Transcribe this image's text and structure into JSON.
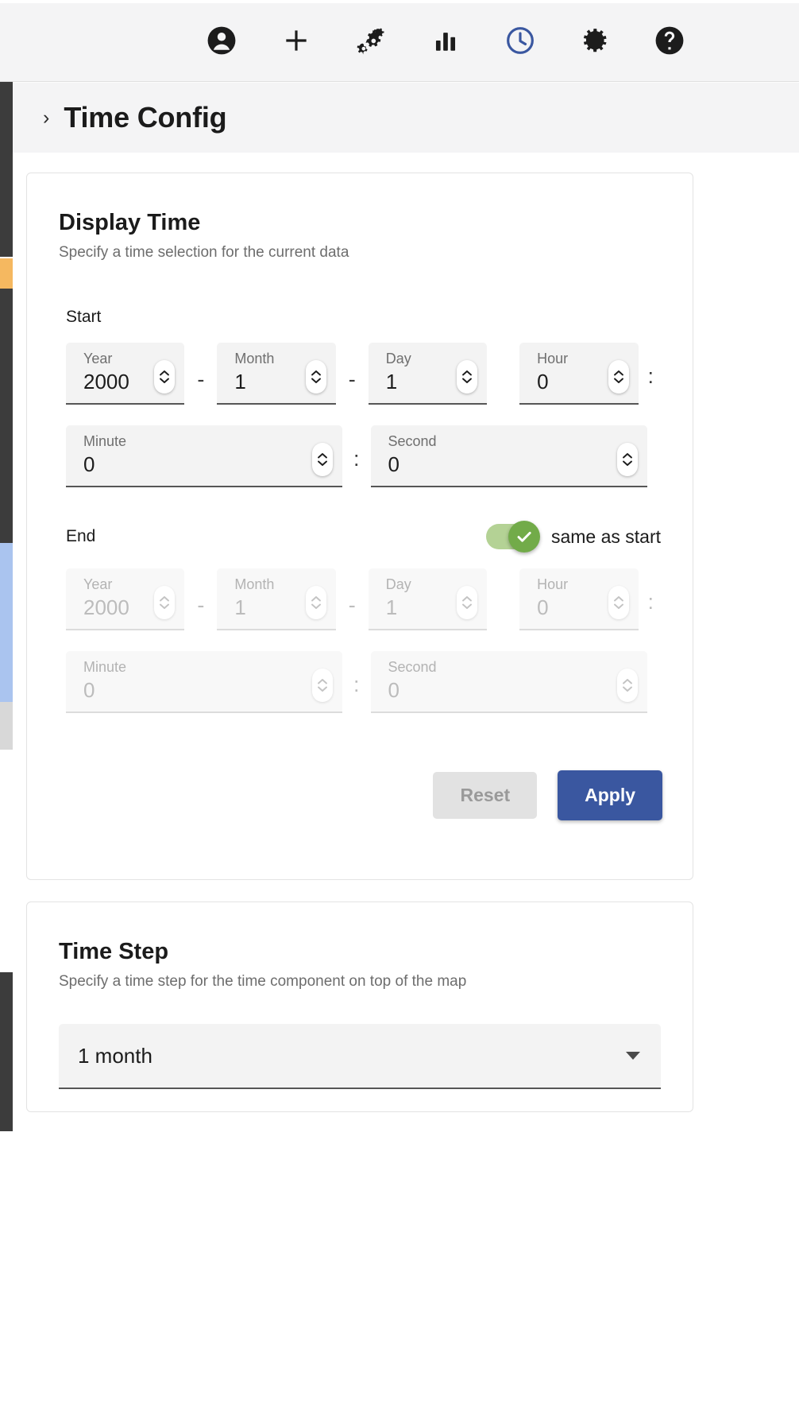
{
  "toolbar": {
    "icons": [
      {
        "name": "account-circle-icon",
        "label": "Account"
      },
      {
        "name": "plus-icon",
        "label": "Add"
      },
      {
        "name": "settings-suggest-gears-icon",
        "label": "Processing"
      },
      {
        "name": "bar-chart-icon",
        "label": "Charts"
      },
      {
        "name": "clock-icon",
        "label": "Time Config"
      },
      {
        "name": "gear-icon",
        "label": "Settings"
      },
      {
        "name": "help-icon",
        "label": "Help"
      }
    ],
    "active_icon": "clock-icon",
    "active_color": "#3a57a0"
  },
  "header": {
    "chevron": "›",
    "title": "Time Config"
  },
  "display_time": {
    "title": "Display Time",
    "subtitle": "Specify a time selection for the current data",
    "start": {
      "label": "Start",
      "fields": [
        {
          "label": "Year",
          "value": "2000"
        },
        {
          "label": "Month",
          "value": "1"
        },
        {
          "label": "Day",
          "value": "1"
        },
        {
          "label": "Hour",
          "value": "0"
        },
        {
          "label": "Minute",
          "value": "0"
        },
        {
          "label": "Second",
          "value": "0"
        }
      ]
    },
    "end": {
      "label": "End",
      "same_as_start_label": "same as start",
      "same_as_start_on": true,
      "toggle_color": "#72ab49",
      "fields": [
        {
          "label": "Year",
          "value": "2000"
        },
        {
          "label": "Month",
          "value": "1"
        },
        {
          "label": "Day",
          "value": "1"
        },
        {
          "label": "Hour",
          "value": "0"
        },
        {
          "label": "Minute",
          "value": "0"
        },
        {
          "label": "Second",
          "value": "0"
        }
      ]
    },
    "separators": {
      "dash": "-",
      "colon": ":"
    },
    "buttons": {
      "reset": "Reset",
      "apply": "Apply",
      "apply_color": "#3a57a0"
    }
  },
  "time_step": {
    "title": "Time Step",
    "subtitle": "Specify a time step for the time component on top of the map",
    "selected": "1 month"
  }
}
